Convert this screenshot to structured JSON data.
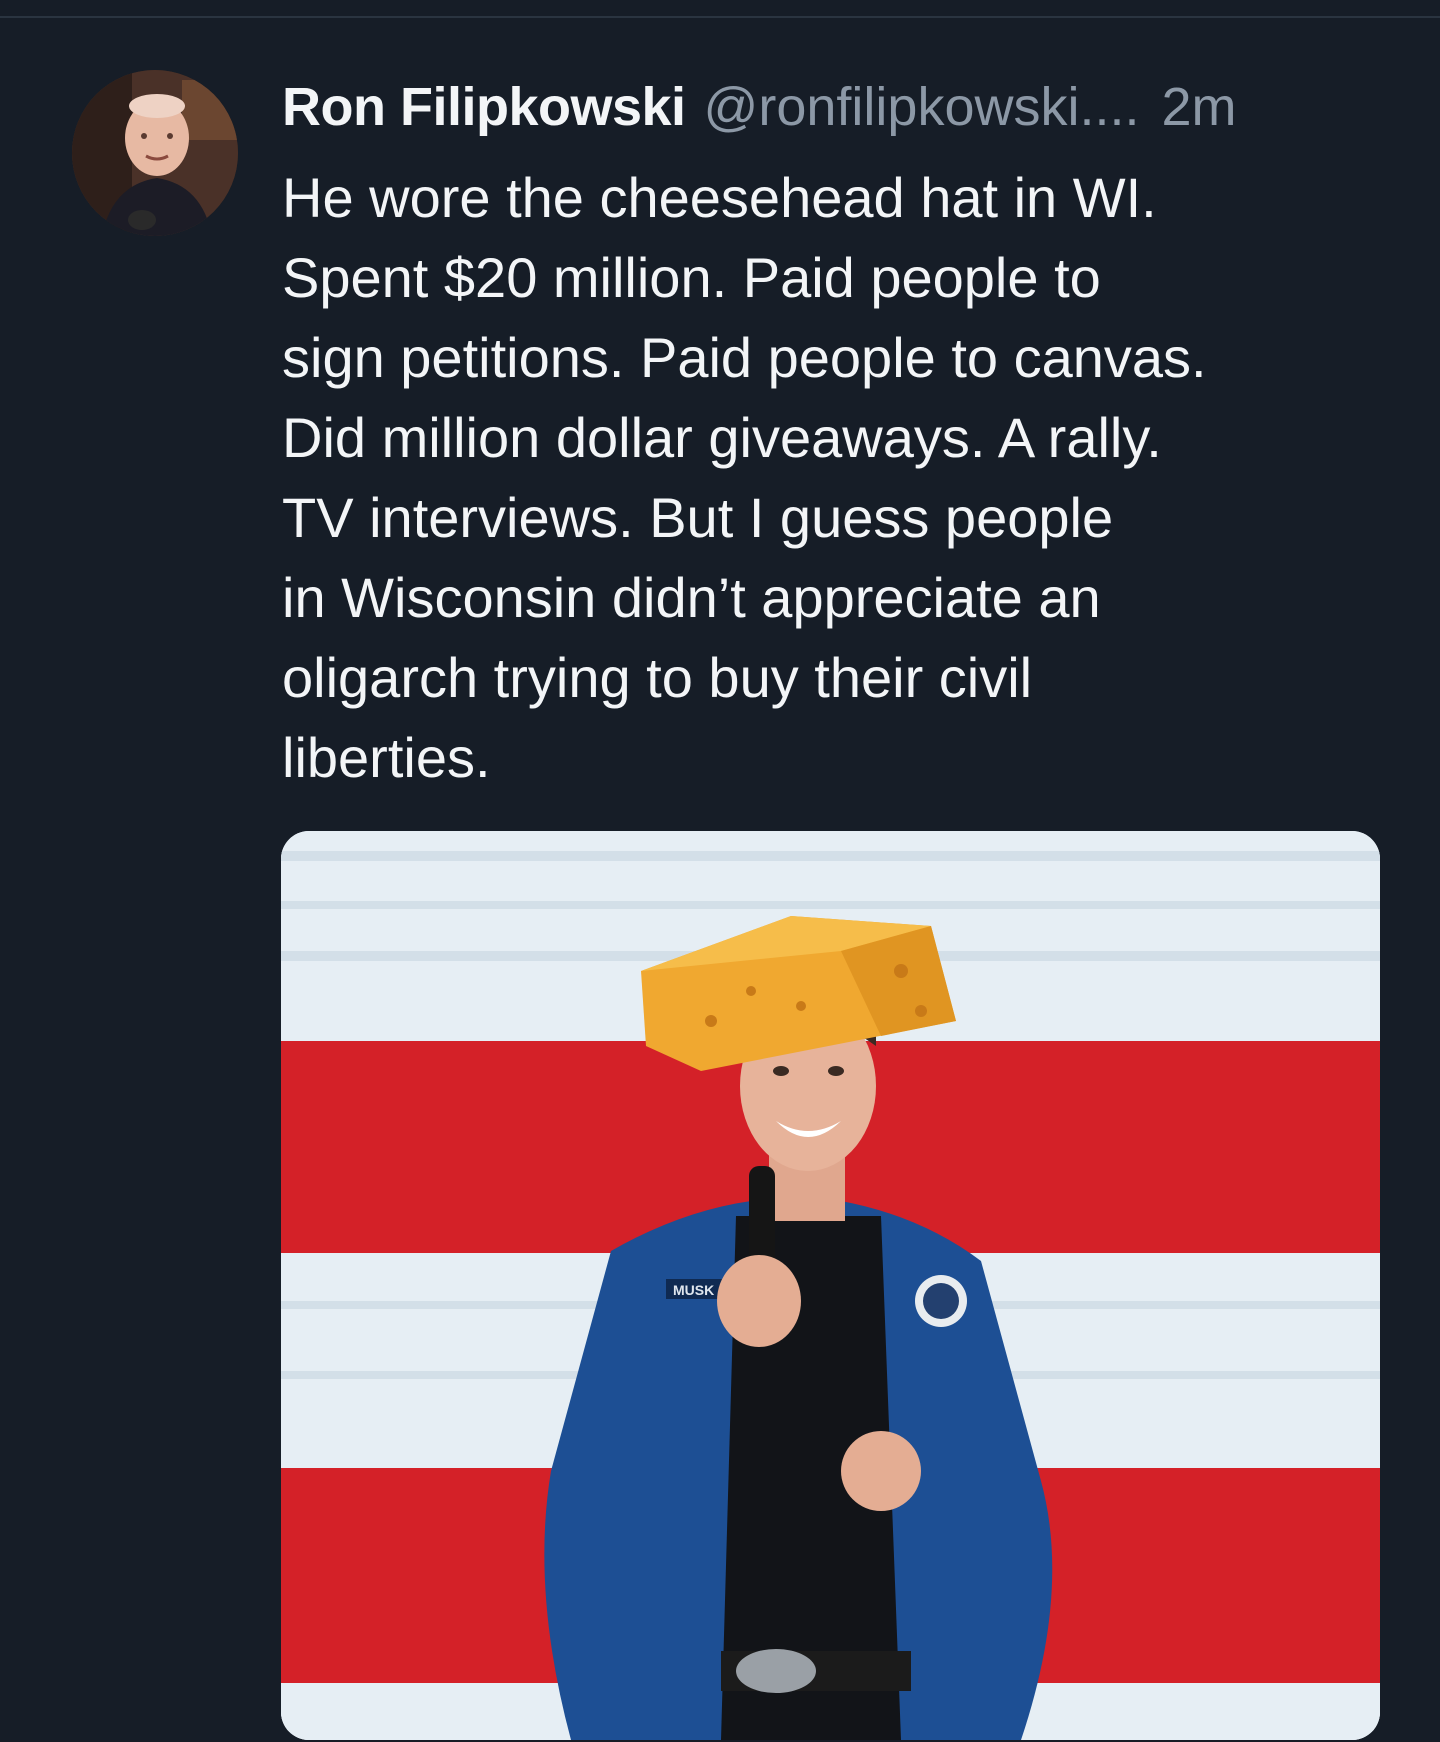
{
  "tweet": {
    "author_name": "Ron Filipkowski",
    "handle": "@ronfilipkowski....",
    "time": "2m",
    "text_lines": [
      "He wore the cheesehead hat in WI.",
      "Spent $20 million. Paid people to",
      "sign petitions. Paid people to canvas.",
      "Did million dollar giveaways. A rally.",
      "TV interviews. But I guess people",
      "in Wisconsin didn’t appreciate an",
      "oligarch trying to buy their civil",
      "liberties."
    ],
    "media": {
      "name_tag": "MUSK"
    }
  },
  "colors": {
    "background": "#161d27",
    "text_primary": "#f3f5f7",
    "text_secondary": "#8c98a6",
    "flag_red": "#d42128",
    "flag_white": "#e6eef4",
    "cheese": "#f0a830",
    "jacket": "#1d4f94"
  },
  "icons": {
    "avatar": "profile-photo",
    "media": "photo"
  }
}
